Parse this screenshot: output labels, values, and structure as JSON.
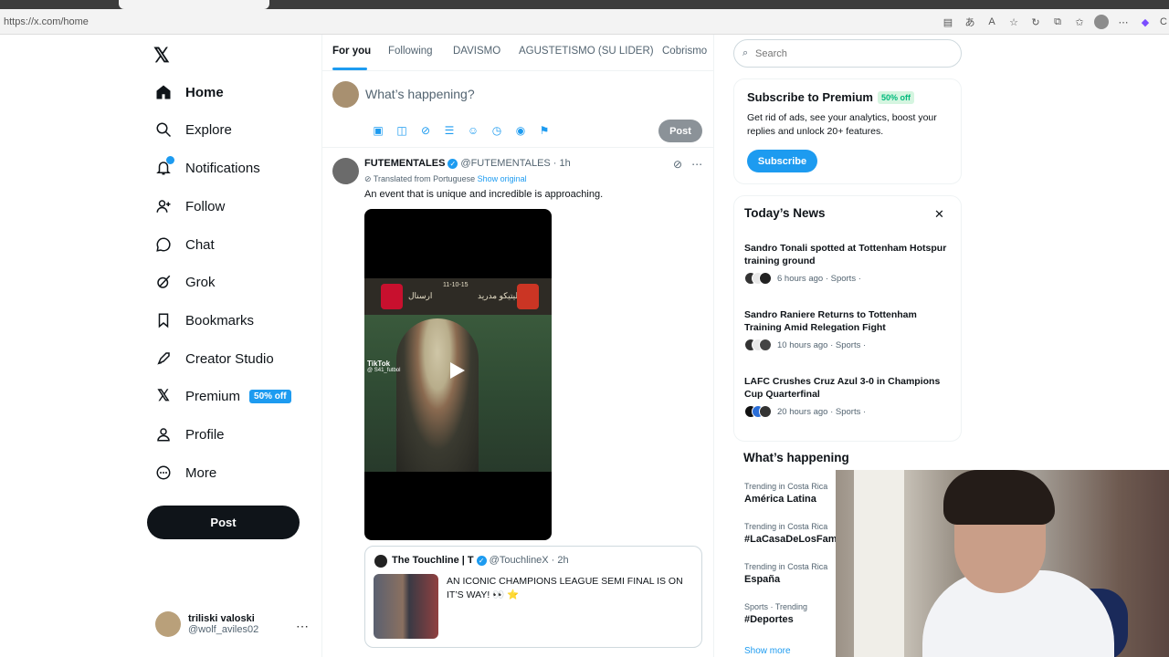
{
  "browser": {
    "url": "https://x.com/home"
  },
  "nav": {
    "items": [
      {
        "label": "Home",
        "icon": "home-icon"
      },
      {
        "label": "Explore",
        "icon": "search-icon"
      },
      {
        "label": "Notifications",
        "icon": "bell-icon"
      },
      {
        "label": "Follow",
        "icon": "follow-icon"
      },
      {
        "label": "Chat",
        "icon": "chat-icon"
      },
      {
        "label": "Grok",
        "icon": "grok-icon"
      },
      {
        "label": "Bookmarks",
        "icon": "bookmark-icon"
      },
      {
        "label": "Creator Studio",
        "icon": "rocket-icon"
      },
      {
        "label": "Premium",
        "icon": "x-logo-icon"
      },
      {
        "label": "Profile",
        "icon": "person-icon"
      },
      {
        "label": "More",
        "icon": "more-circle-icon"
      }
    ],
    "premium_badge": "50% off",
    "post_label": "Post",
    "account": {
      "name": "triliski valoski",
      "handle": "@wolf_aviles02"
    }
  },
  "feed": {
    "tabs": [
      "For you",
      "Following",
      "DAVISMO",
      "AGUSTETISMO (SU LIDER)",
      "Cobrismo"
    ],
    "compose_placeholder": "What’s happening?",
    "compose_post_label": "Post",
    "tweet": {
      "name": "FUTEMENTALES",
      "handle": "@FUTEMENTALES",
      "time": "· 1h",
      "translated": "Translated from Portuguese",
      "show_original": "Show original",
      "text": "An event that is unique and incredible is approaching.",
      "video_overlay": "TikTok",
      "video_overlay_handle": "@ S41_futbol",
      "video_team_left": "ارسنال",
      "video_team_right": "اتليتيكو مدريد",
      "video_score": "11-10-15",
      "quote": {
        "name": "The Touchline | T",
        "handle": "@TouchlineX",
        "time": "· 2h",
        "text": "AN ICONIC CHAMPIONS LEAGUE SEMI FINAL IS ON IT’S WAY! 👀 ⭐"
      }
    }
  },
  "sidebar": {
    "search_placeholder": "Search",
    "premium": {
      "title": "Subscribe to Premium",
      "badge": "50% off",
      "desc": "Get rid of ads, see your analytics, boost your replies and unlock 20+ features.",
      "button": "Subscribe"
    },
    "news": {
      "title": "Today’s News",
      "items": [
        {
          "headline": "Sandro Tonali spotted at Tottenham Hotspur training ground",
          "meta": "6 hours ago · Sports ·"
        },
        {
          "headline": "Sandro Raniere Returns to Tottenham Training Amid Relegation Fight",
          "meta": "10 hours ago · Sports ·"
        },
        {
          "headline": "LAFC Crushes Cruz Azul 3-0 in Champions Cup Quarterfinal",
          "meta": "20 hours ago · Sports ·"
        }
      ]
    },
    "happening": {
      "title": "What’s happening",
      "trends": [
        {
          "context": "Trending in Costa Rica",
          "name": "América Latina"
        },
        {
          "context": "Trending in Costa Rica",
          "name": "#LaCasaDeLosFam"
        },
        {
          "context": "Trending in Costa Rica",
          "name": "España"
        },
        {
          "context": "Sports · Trending",
          "name": "#Deportes"
        }
      ],
      "show_more": "Show more"
    }
  },
  "colors": {
    "accent": "#1d9bf0",
    "text": "#0f1419",
    "muted": "#536471",
    "green": "#00ba7c"
  }
}
